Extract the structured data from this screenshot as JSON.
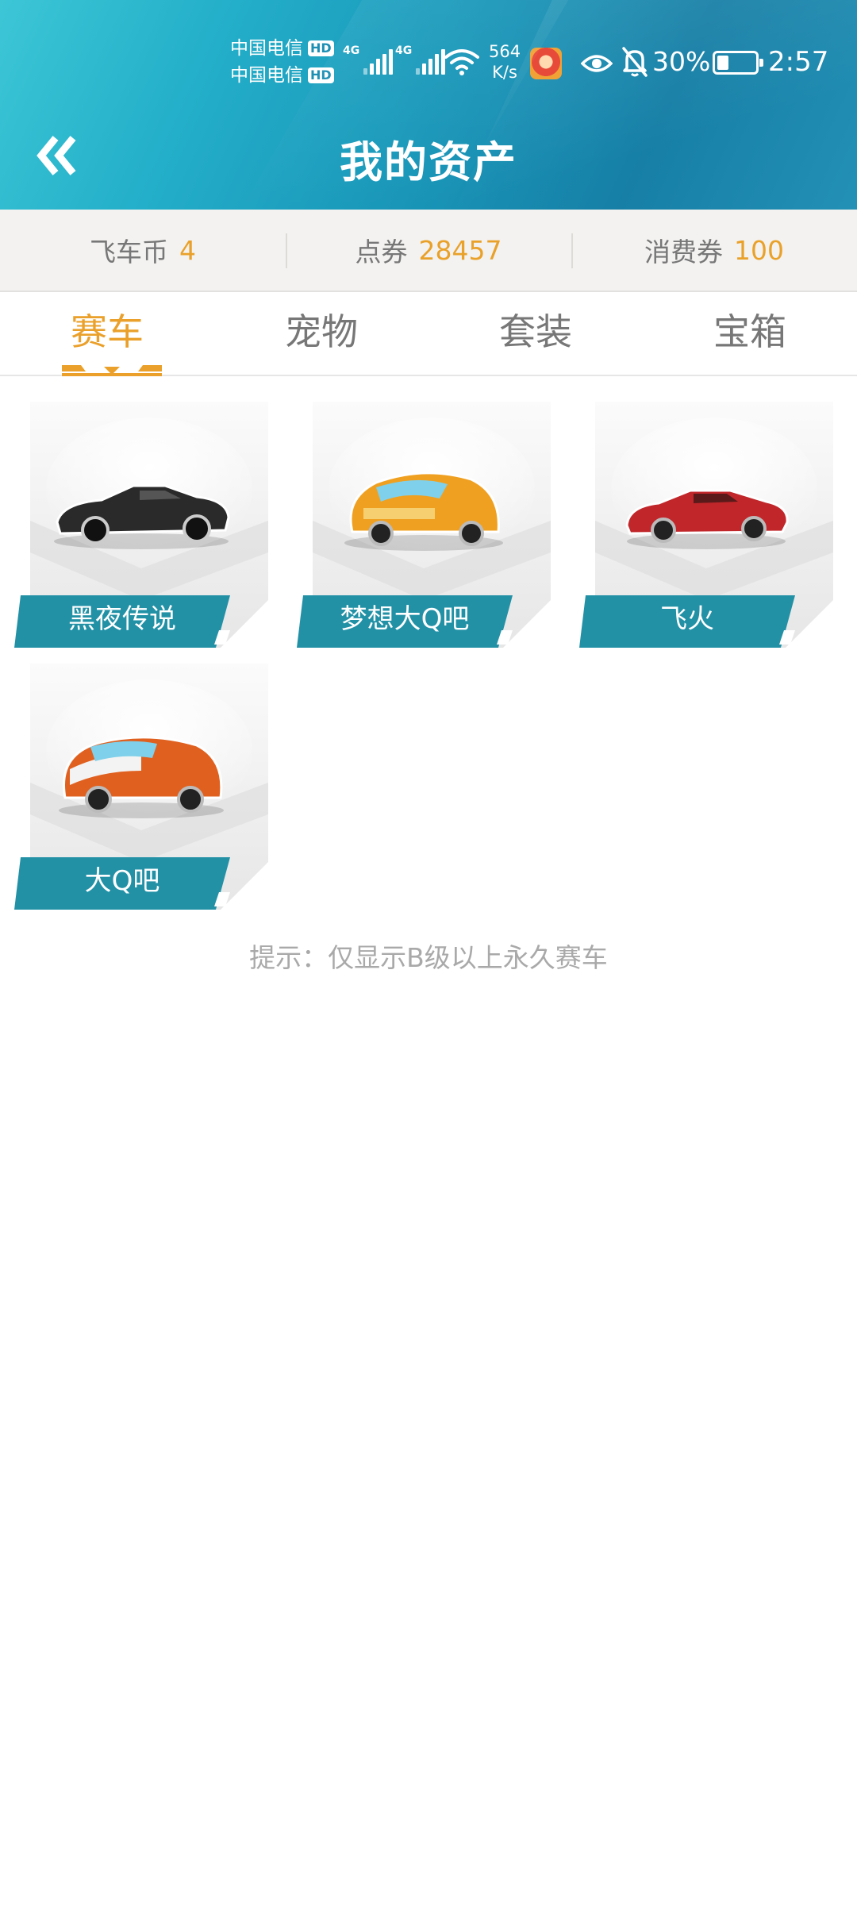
{
  "status_bar": {
    "carrier1": "中国电信",
    "carrier2": "中国电信",
    "hd": "HD",
    "network1": "4G",
    "network2": "4G",
    "speed_value": "564",
    "speed_unit": "K/s",
    "battery_text": "30%",
    "battery_level": 0.3,
    "time": "2:57"
  },
  "header": {
    "title": "我的资产"
  },
  "currency": [
    {
      "label": "飞车币",
      "value": "4"
    },
    {
      "label": "点券",
      "value": "28457"
    },
    {
      "label": "消费券",
      "value": "100"
    }
  ],
  "tabs": [
    {
      "label": "赛车",
      "active": true
    },
    {
      "label": "宠物",
      "active": false
    },
    {
      "label": "套装",
      "active": false
    },
    {
      "label": "宝箱",
      "active": false
    }
  ],
  "cars": [
    {
      "name": "黑夜传说",
      "color": "#2a2a2a"
    },
    {
      "name": "梦想大Q吧",
      "color": "#f0a020"
    },
    {
      "name": "飞火",
      "color": "#c0262a"
    },
    {
      "name": "大Q吧",
      "color": "#e0601f"
    }
  ],
  "hint": "提示：仅显示B级以上永久赛车",
  "colors": {
    "accent": "#eaa02a",
    "label_bg": "#2291a6",
    "header": "#1b9fc0"
  }
}
